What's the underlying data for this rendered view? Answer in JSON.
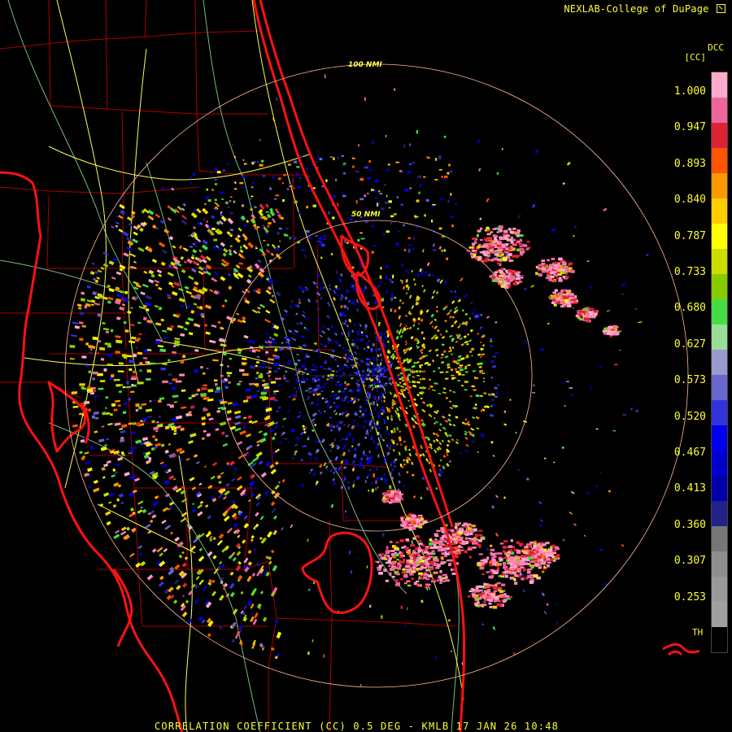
{
  "header": {
    "credit": "NEXLAB-College of DuPage",
    "credit_icon": "corner-arrow-icon"
  },
  "legend": {
    "product_code": "DCC",
    "unit": "[CC]",
    "ticks": [
      "1.000",
      "0.947",
      "0.893",
      "0.840",
      "0.787",
      "0.733",
      "0.680",
      "0.627",
      "0.573",
      "0.520",
      "0.467",
      "0.413",
      "0.360",
      "0.307",
      "0.253"
    ],
    "threshold_label": "TH",
    "colors": [
      "#ffaacc",
      "#ee6699",
      "#dd2233",
      "#ff5500",
      "#ff9900",
      "#ffcc00",
      "#ffff00",
      "#ccdd00",
      "#88cc00",
      "#44dd44",
      "#99dd99",
      "#9999cc",
      "#6666cc",
      "#3333dd",
      "#0000ee",
      "#0000cc",
      "#0000aa",
      "#222288",
      "#777777",
      "#8f8f8f",
      "#999999",
      "#a0a0a0",
      "#000000"
    ]
  },
  "map": {
    "range_rings": [
      {
        "label": "100 NMI"
      },
      {
        "label": "50 NMI"
      }
    ],
    "colors": {
      "coastline": "#ff1111",
      "county_lines": "#aa0000",
      "highways": "#ffff55",
      "rivers": "#88cc88",
      "range_rings": "#ffbb99"
    }
  },
  "footer": {
    "product_label": "CORRELATION COEFFICIENT (CC) 0.5 DEG - KMLB 17 JAN 26 10:48"
  }
}
